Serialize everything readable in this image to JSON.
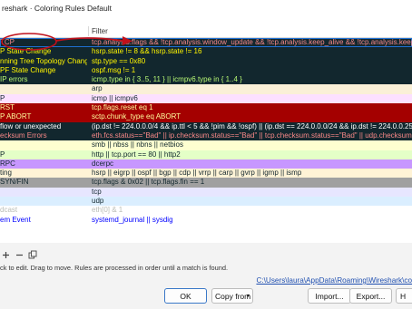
{
  "window": {
    "title": "reshark · Coloring Rules Default"
  },
  "table": {
    "headers": {
      "name": "",
      "filter": "Filter"
    },
    "rows": [
      {
        "name": "TCP",
        "filter": "tcp.analysis.flags && !tcp.analysis.window_update && !tcp.analysis.keep_alive && !tcp.analysis.keep_alive_a",
        "bg": "#12272e",
        "fg": "#f78787",
        "selected": true
      },
      {
        "name": "P State Change",
        "filter": "hsrp.state != 8 && hsrp.state != 16",
        "bg": "#12272e",
        "fg": "#fff600"
      },
      {
        "name": "nning Tree Topology  Change",
        "filter": "stp.type == 0x80",
        "bg": "#12272e",
        "fg": "#fff600"
      },
      {
        "name": "PF State Change",
        "filter": "ospf.msg != 1",
        "bg": "#12272e",
        "fg": "#fff600"
      },
      {
        "name": "IP errors",
        "filter": "icmp.type in { 3..5, 11 } || icmpv6.type in { 1..4 }",
        "bg": "#12272e",
        "fg": "#b7f774"
      },
      {
        "name": "",
        "filter": "arp",
        "bg": "#faf0d7",
        "fg": "#12272e"
      },
      {
        "name": "P",
        "filter": "icmp || icmpv6",
        "bg": "#fce0ff",
        "fg": "#12272e"
      },
      {
        "name": "RST",
        "filter": "tcp.flags.reset eq 1",
        "bg": "#a40000",
        "fg": "#fffc9c"
      },
      {
        "name": "P ABORT",
        "filter": "sctp.chunk_type eq ABORT",
        "bg": "#a40000",
        "fg": "#fffc9c"
      },
      {
        "name": "flow or unexpected",
        "filter": "(ip.dst != 224.0.0.0/4 && ip.ttl < 5 && !pim && !ospf) || (ip.dst == 224.0.0.0/24 && ip.dst != 224.0.0.251 &&",
        "bg": "#12272e",
        "fg": "#ffffff"
      },
      {
        "name": "ecksum Errors",
        "filter": "eth.fcs.status==\"Bad\" || ip.checksum.status==\"Bad\" || tcp.checksum.status==\"Bad\" || udp.checksum.status==\"Bad\"",
        "bg": "#12272e",
        "fg": "#f78787"
      },
      {
        "name": "",
        "filter": "smb || nbss || nbns || netbios",
        "bg": "#feffd0",
        "fg": "#12272e"
      },
      {
        "name": "P",
        "filter": "http || tcp.port == 80 || http2",
        "bg": "#e4ffc7",
        "fg": "#12272e"
      },
      {
        "name": "RPC",
        "filter": "dcerpc",
        "bg": "#c797ff",
        "fg": "#12272e"
      },
      {
        "name": "ting",
        "filter": "hsrp || eigrp || ospf || bgp || cdp || vrrp || carp || gvrp || igmp || ismp",
        "bg": "#fff3d6",
        "fg": "#12272e"
      },
      {
        "name": "SYN/FIN",
        "filter": "tcp.flags & 0x02 || tcp.flags.fin == 1",
        "bg": "#a0a0a0",
        "fg": "#12272e"
      },
      {
        "name": "",
        "filter": "tcp",
        "bg": "#e7e6ff",
        "fg": "#12272e"
      },
      {
        "name": "",
        "filter": "udp",
        "bg": "#daeeff",
        "fg": "#12272e"
      },
      {
        "name": "dcast",
        "filter": "eth[0] & 1",
        "bg": "#ffffff",
        "fg": "#babdb6"
      },
      {
        "name": "em Event",
        "filter": "systemd_journal || sysdig",
        "bg": "#ffffff",
        "fg": "#0000ff"
      }
    ]
  },
  "hint": "ck to edit. Drag to move. Rules are processed in order until a match is found.",
  "path_link": "C:\\Users\\laura\\AppData\\Roaming\\Wireshark\\co",
  "buttons": {
    "ok": "OK",
    "copy_from": "Copy from",
    "import": "Import...",
    "export": "Export...",
    "help": "H"
  },
  "icons": {
    "add": "plus-icon",
    "remove": "minus-icon",
    "copy": "copy-icon"
  },
  "colors": {
    "selection_outline": "#1f6fd1",
    "annotation_arrow": "#c0101b"
  }
}
